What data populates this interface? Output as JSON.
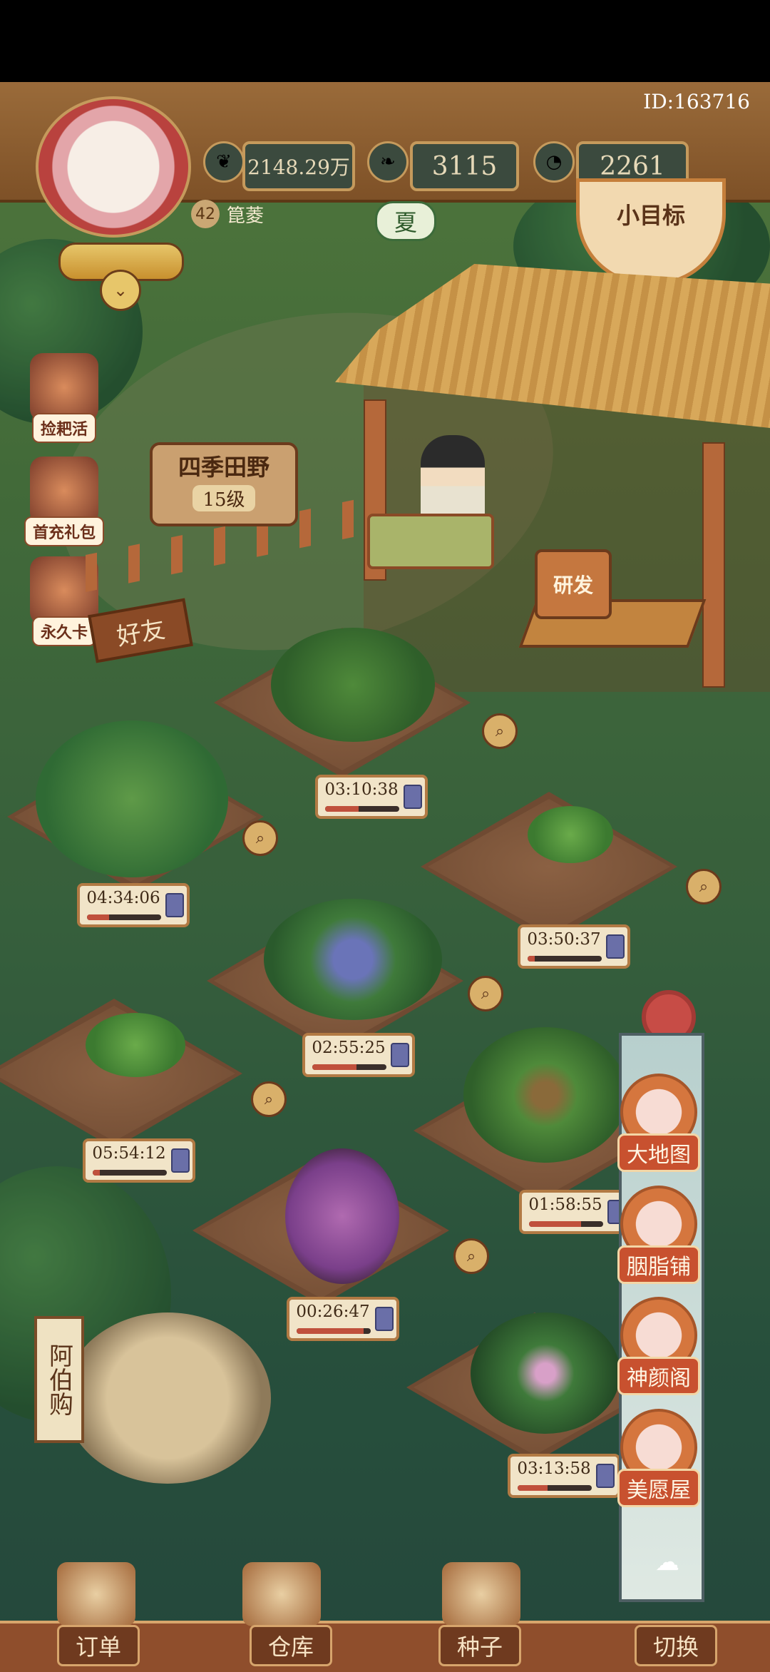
{
  "header": {
    "player_id": "ID:163716",
    "resources": [
      {
        "icon": "heart-coin-icon",
        "value": "2148.29万"
      },
      {
        "icon": "leaf-icon",
        "value": "3115"
      },
      {
        "icon": "clock-icon",
        "value": "2261"
      }
    ],
    "level": "42",
    "player_name": "箟菱",
    "season": "夏",
    "goal_label": "小目标"
  },
  "left_menu": [
    {
      "name": "chest",
      "label": "捡耙活"
    },
    {
      "name": "first-recharge",
      "label": "首充礼包"
    },
    {
      "name": "permanent-card",
      "label": "永久卡"
    }
  ],
  "farm": {
    "sign_title": "四季田野",
    "sign_level": "15级",
    "friends_label": "好友",
    "research_label": "研发"
  },
  "plots": [
    {
      "timer": "03:10:38",
      "progress": 0.45
    },
    {
      "timer": "04:34:06",
      "progress": 0.3
    },
    {
      "timer": "03:50:37",
      "progress": 0.1
    },
    {
      "timer": "02:55:25",
      "progress": 0.6
    },
    {
      "timer": "05:54:12",
      "progress": 0.1
    },
    {
      "timer": "01:58:55",
      "progress": 0.7
    },
    {
      "timer": "00:26:47",
      "progress": 0.9
    },
    {
      "timer": "03:13:58",
      "progress": 0.4
    }
  ],
  "shop_sign": "阿伯购",
  "right_nav": [
    {
      "icon": "back-arrow-icon",
      "label": "大地图"
    },
    {
      "icon": "rouge-shop-icon",
      "label": "胭脂铺"
    },
    {
      "icon": "beauty-pavilion-icon",
      "label": "神颜阁"
    },
    {
      "icon": "wish-house-icon",
      "label": "美愿屋"
    }
  ],
  "bottom_tabs": [
    {
      "label": "订单"
    },
    {
      "label": "仓库"
    },
    {
      "label": "种子"
    },
    {
      "label": "切换"
    }
  ],
  "colors": {
    "accent": "#c8512f",
    "wood": "#8f4e2c",
    "grass": "#4f7c40"
  }
}
